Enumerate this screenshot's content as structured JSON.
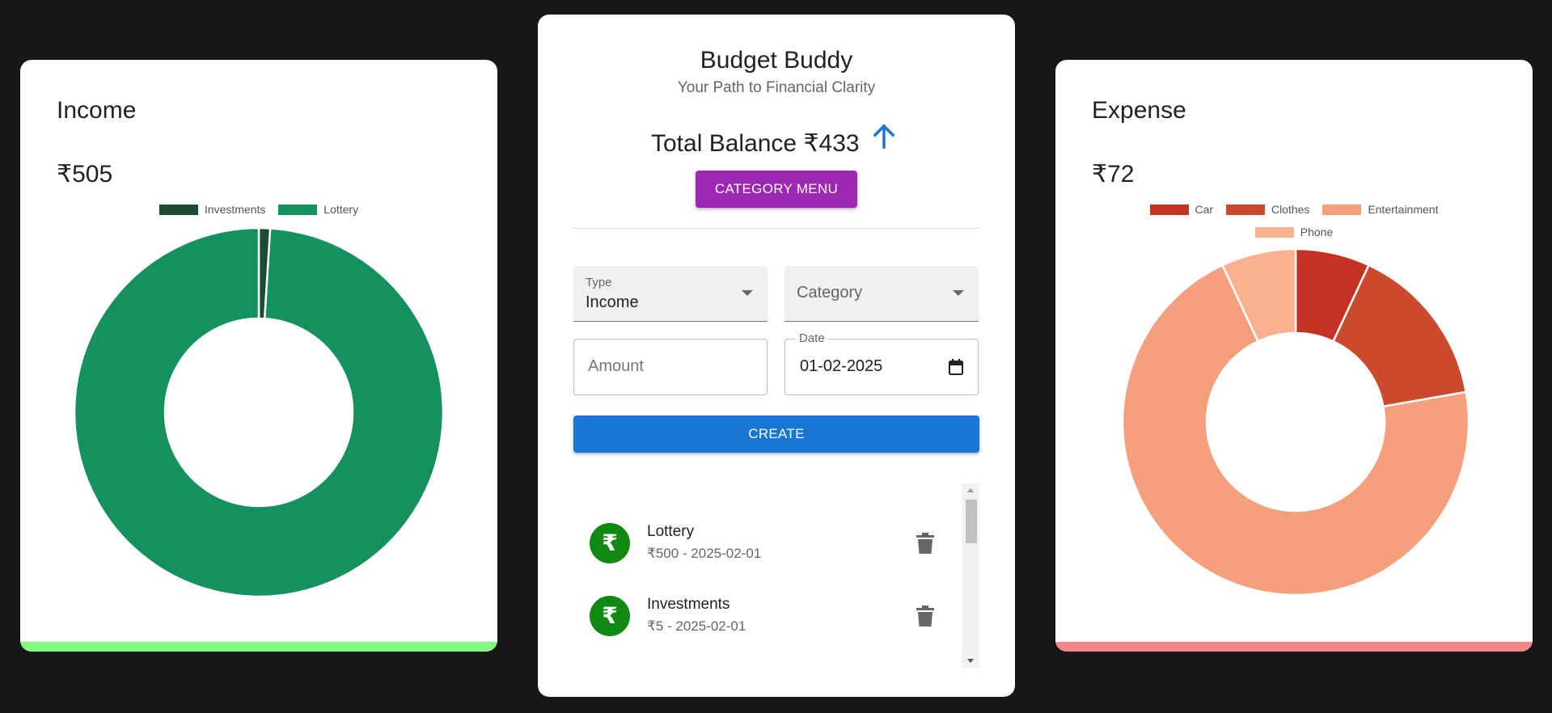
{
  "income": {
    "title": "Income",
    "amount": "₹505",
    "bar_color": "#80fc80",
    "chart_data": {
      "type": "pie",
      "title": "",
      "categories": [
        "Investments",
        "Lottery"
      ],
      "values": [
        5,
        500
      ],
      "colors": [
        "#1d4c35",
        "#159160"
      ],
      "legend": "top"
    }
  },
  "expense": {
    "title": "Expense",
    "amount": "₹72",
    "bar_color": "#f68686",
    "chart_data": {
      "type": "pie",
      "title": "",
      "categories": [
        "Car",
        "Clothes",
        "Entertainment",
        "Phone"
      ],
      "values": [
        5,
        11,
        51,
        5
      ],
      "colors": [
        "#c33223",
        "#cb4a2d",
        "#f59f7d",
        "#fbb08f"
      ],
      "legend": "top"
    }
  },
  "app": {
    "title": "Budget Buddy",
    "subtitle": "Your Path to Financial Clarity",
    "balance": "Total Balance ₹433",
    "category_menu_label": "CATEGORY MENU",
    "create_label": "CREATE"
  },
  "form": {
    "type_label": "Type",
    "type_value": "Income",
    "category_placeholder": "Category",
    "amount_placeholder": "Amount",
    "date_label": "Date",
    "date_value": "01-02-2025"
  },
  "transactions": [
    {
      "avatar": "₹",
      "title": "Lottery",
      "detail": "₹500 - 2025-02-01"
    },
    {
      "avatar": "₹",
      "title": "Investments",
      "detail": "₹5 - 2025-02-01"
    }
  ],
  "colors": {
    "accent_purple": "#9c27b0",
    "accent_blue": "#1976d2",
    "avatar_green": "#118811",
    "background": "#171818"
  },
  "icons": [
    "arrow-up-icon",
    "calendar-icon",
    "trash-icon",
    "rupee-avatar-icon"
  ]
}
